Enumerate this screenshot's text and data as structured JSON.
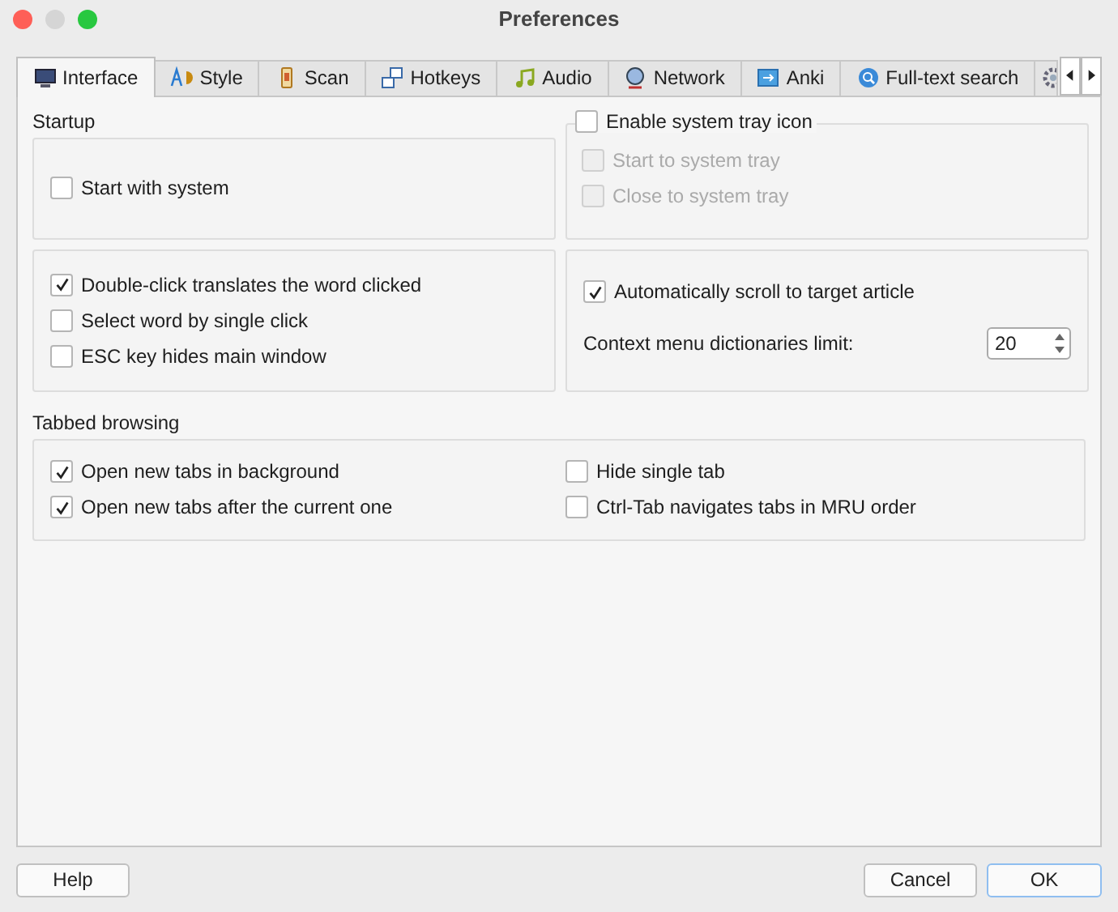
{
  "window": {
    "title": "Preferences"
  },
  "tabs": [
    {
      "label": "Interface",
      "selected": true
    },
    {
      "label": "Style",
      "selected": false
    },
    {
      "label": "Scan",
      "selected": false
    },
    {
      "label": "Hotkeys",
      "selected": false
    },
    {
      "label": "Audio",
      "selected": false
    },
    {
      "label": "Network",
      "selected": false
    },
    {
      "label": "Anki",
      "selected": false
    },
    {
      "label": "Full-text search",
      "selected": false
    },
    {
      "selected": false
    }
  ],
  "startup": {
    "title": "Startup",
    "options": [
      {
        "label": "Start with system",
        "checked": false,
        "disabled": false
      }
    ]
  },
  "tray": {
    "title": "Enable system tray icon",
    "checked": false,
    "options": [
      {
        "label": "Start to system tray",
        "checked": false,
        "disabled": true
      },
      {
        "label": "Close to system tray",
        "checked": false,
        "disabled": true
      }
    ]
  },
  "clicks": {
    "options": [
      {
        "label": "Double-click translates the word clicked",
        "checked": true,
        "disabled": false
      },
      {
        "label": "Select word by single click",
        "checked": false,
        "disabled": false
      },
      {
        "label": "ESC key hides main window",
        "checked": false,
        "disabled": false
      }
    ]
  },
  "scroll": {
    "options": [
      {
        "label": "Automatically scroll to target article",
        "checked": true,
        "disabled": false
      }
    ],
    "limit_label": "Context menu dictionaries limit:",
    "limit_value": "20"
  },
  "tabbed": {
    "title": "Tabbed browsing",
    "left": [
      {
        "label": "Open new tabs in background",
        "checked": true,
        "disabled": false
      },
      {
        "label": "Open new tabs after the current one",
        "checked": true,
        "disabled": false
      }
    ],
    "right": [
      {
        "label": "Hide single tab",
        "checked": false,
        "disabled": false
      },
      {
        "label": "Ctrl-Tab navigates tabs in MRU order",
        "checked": false,
        "disabled": false
      }
    ]
  },
  "buttons": {
    "help": "Help",
    "cancel": "Cancel",
    "ok": "OK"
  }
}
